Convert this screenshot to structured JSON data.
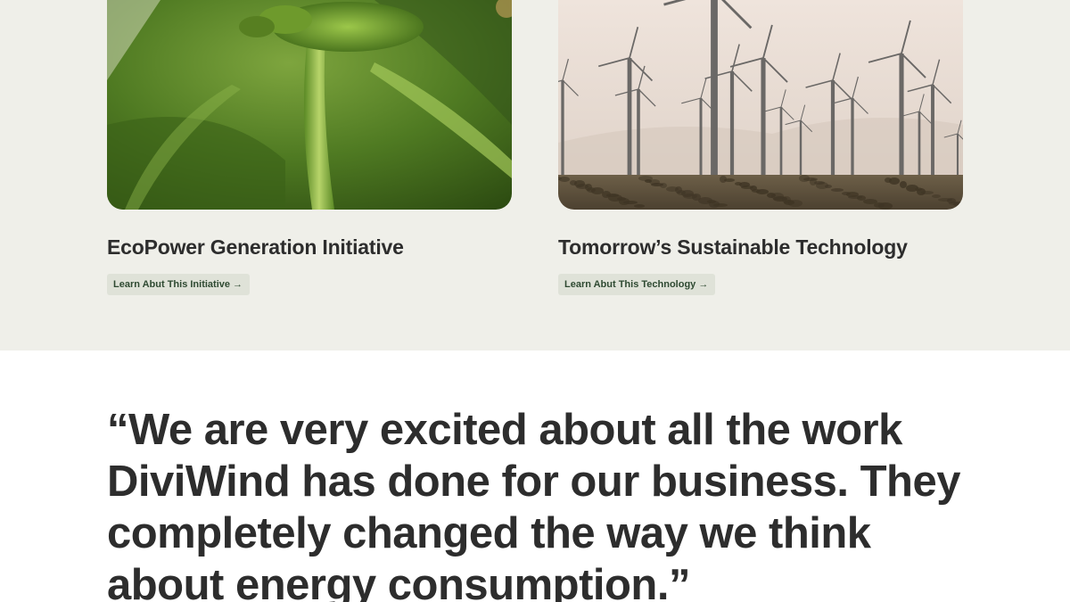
{
  "cards": [
    {
      "title": "EcoPower Generation Initiative",
      "button_label": "Learn Abut This Initiative →",
      "image_subject": "green plant leaf close-up"
    },
    {
      "title": "Tomorrow’s Sustainable Technology",
      "button_label": "Learn Abut This Technology →",
      "image_subject": "wind turbine farm"
    }
  ],
  "testimonial": {
    "quote": "“We are very excited about all the work DiviWind has done for our business. They completely changed the way we think about energy consumption.”"
  },
  "colors": {
    "section_background": "#efefe9",
    "text": "#2d2d2d",
    "button_background": "#dfe2d8",
    "button_text": "#2f4a32"
  }
}
